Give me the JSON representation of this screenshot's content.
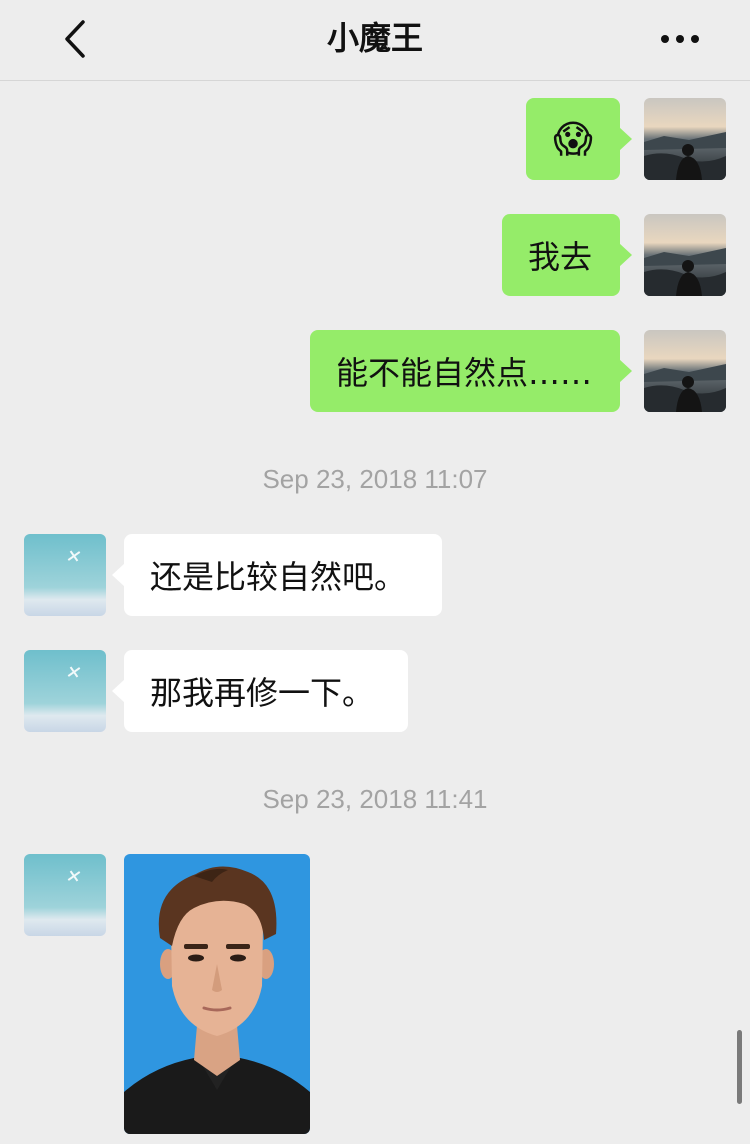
{
  "header": {
    "title": "小魔王",
    "back_icon": "chevron-left-icon",
    "more_icon": "more-horizontal-icon"
  },
  "messages": [
    {
      "direction": "out",
      "type": "emoji",
      "text": "😱"
    },
    {
      "direction": "out",
      "type": "text",
      "text": "我去"
    },
    {
      "direction": "out",
      "type": "text",
      "text": "能不能自然点……"
    },
    {
      "type": "timestamp",
      "text": "Sep 23, 2018 11:07"
    },
    {
      "direction": "in",
      "type": "text",
      "text": "还是比较自然吧。"
    },
    {
      "direction": "in",
      "type": "text",
      "text": "那我再修一下。"
    },
    {
      "type": "timestamp",
      "text": "Sep 23, 2018 11:41"
    },
    {
      "direction": "in",
      "type": "image",
      "image": "portrait-photo"
    }
  ],
  "colors": {
    "background": "#ededed",
    "outgoing_bubble": "#95ec69",
    "incoming_bubble": "#ffffff",
    "timestamp_text": "#a3a3a3",
    "photo_background": "#2f96e0"
  }
}
